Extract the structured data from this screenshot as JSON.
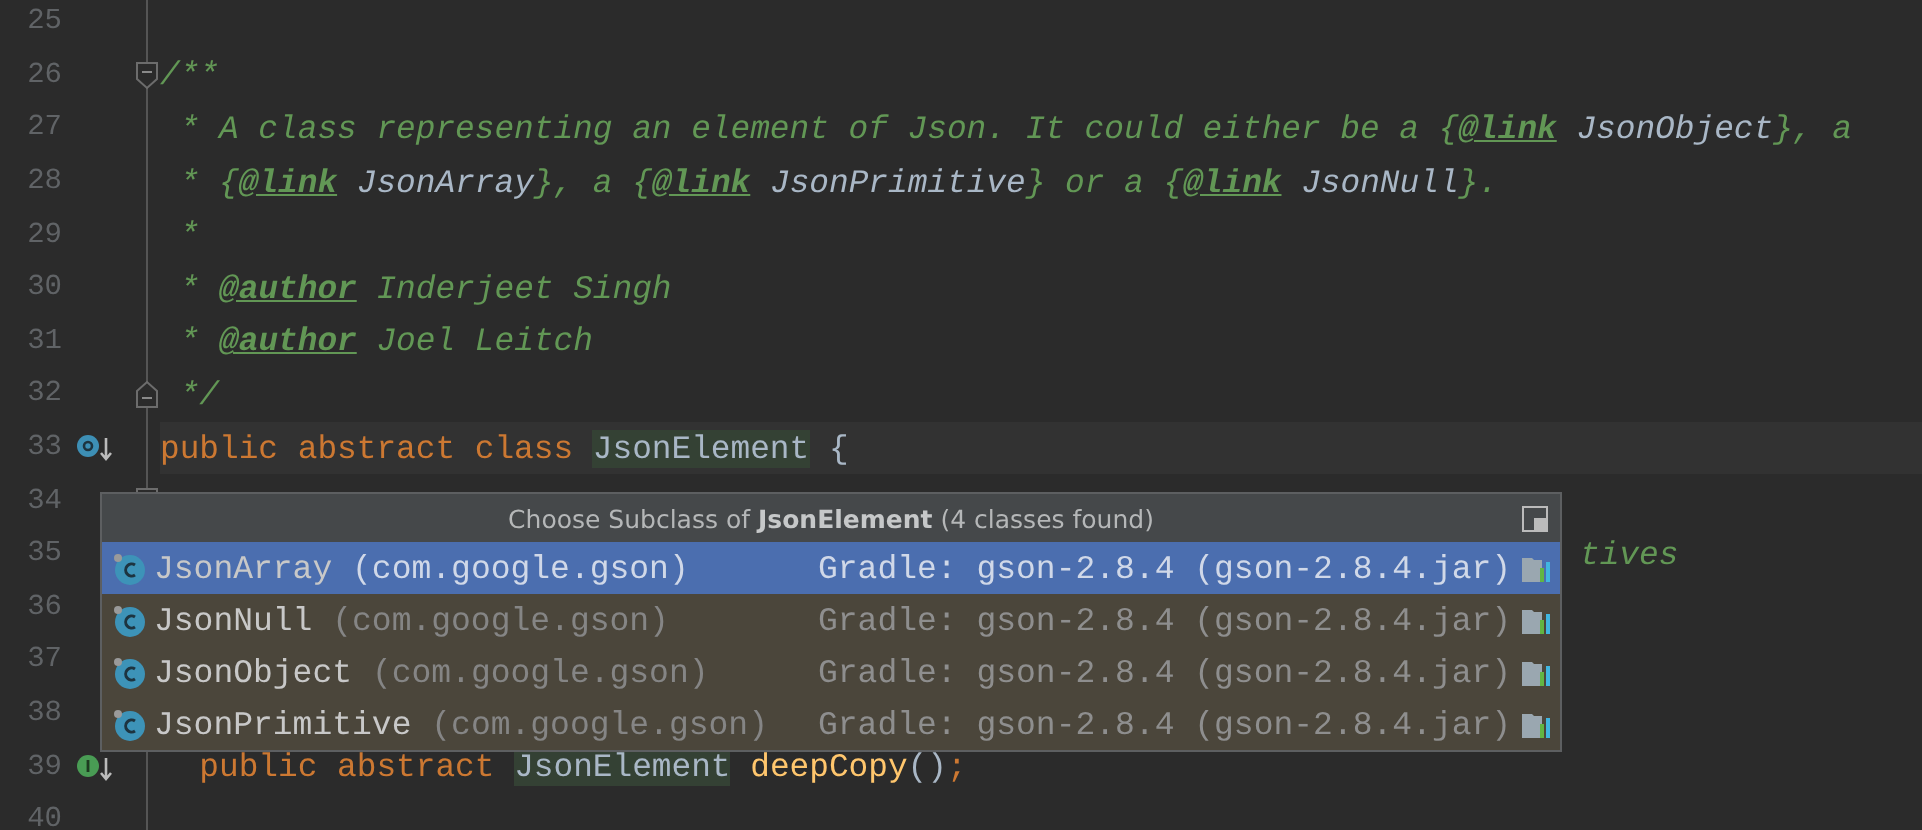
{
  "editor": {
    "lines": [
      {
        "number": "25"
      },
      {
        "number": "26",
        "fold_start": true,
        "tokens": [
          {
            "kind": "comment",
            "text": "/**"
          }
        ]
      },
      {
        "number": "27",
        "tokens": [
          {
            "kind": "comment",
            "text": " * A class representing an element of Json. It could either be a {"
          },
          {
            "kind": "tag",
            "text": "@link"
          },
          {
            "kind": "ref",
            "text": " JsonObject"
          },
          {
            "kind": "comment",
            "text": "}, a"
          }
        ]
      },
      {
        "number": "28",
        "tokens": [
          {
            "kind": "comment",
            "text": " * {"
          },
          {
            "kind": "tag",
            "text": "@link"
          },
          {
            "kind": "ref",
            "text": " JsonArray"
          },
          {
            "kind": "comment",
            "text": "}, a {"
          },
          {
            "kind": "tag",
            "text": "@link"
          },
          {
            "kind": "ref",
            "text": " JsonPrimitive"
          },
          {
            "kind": "comment",
            "text": "} or a {"
          },
          {
            "kind": "tag",
            "text": "@link"
          },
          {
            "kind": "ref",
            "text": " JsonNull"
          },
          {
            "kind": "comment",
            "text": "}."
          }
        ]
      },
      {
        "number": "29",
        "tokens": [
          {
            "kind": "comment",
            "text": " *"
          }
        ]
      },
      {
        "number": "30",
        "tokens": [
          {
            "kind": "comment",
            "text": " * "
          },
          {
            "kind": "tag",
            "text": "@author"
          },
          {
            "kind": "comment",
            "text": " Inderjeet Singh"
          }
        ]
      },
      {
        "number": "31",
        "tokens": [
          {
            "kind": "comment",
            "text": " * "
          },
          {
            "kind": "tag",
            "text": "@author"
          },
          {
            "kind": "comment",
            "text": " Joel Leitch"
          }
        ]
      },
      {
        "number": "32",
        "fold_end": true,
        "tokens": [
          {
            "kind": "comment",
            "text": " */"
          }
        ]
      },
      {
        "number": "33",
        "current": true,
        "has_subclasses": true,
        "tokens": [
          {
            "kind": "keyword",
            "text": "public abstract class "
          },
          {
            "kind": "plain",
            "text": "JsonElement",
            "highlighted": true
          },
          {
            "kind": "plain",
            "text": " {"
          }
        ]
      },
      {
        "number": "34",
        "fold_start": true
      },
      {
        "number": "35",
        "covered": true,
        "tokens": [
          {
            "kind": "comment",
            "text": "tives"
          }
        ]
      },
      {
        "number": "36"
      },
      {
        "number": "37"
      },
      {
        "number": "38"
      },
      {
        "number": "39",
        "implements": true,
        "tokens": [
          {
            "kind": "keyword",
            "text": "  public abstract "
          },
          {
            "kind": "plain",
            "text": "JsonElement",
            "highlighted": true
          },
          {
            "kind": "method",
            "text": " deepCopy"
          },
          {
            "kind": "plain",
            "text": "()"
          },
          {
            "kind": "keyword",
            "text": ";"
          }
        ]
      },
      {
        "number": "40"
      }
    ]
  },
  "chooser": {
    "title": "Choose Subclass of **JsonElement** (4 classes found)",
    "items": [
      {
        "name": "JsonArray",
        "package": "(com.google.gson)",
        "location": "Gradle: gson-2.8.4 (gson-2.8.4.jar)",
        "selected": true
      },
      {
        "name": "JsonNull",
        "package": "(com.google.gson)",
        "location": "Gradle: gson-2.8.4 (gson-2.8.4.jar)",
        "selected": false
      },
      {
        "name": "JsonObject",
        "package": "(com.google.gson)",
        "location": "Gradle: gson-2.8.4 (gson-2.8.4.jar)",
        "selected": false
      },
      {
        "name": "JsonPrimitive",
        "package": "(com.google.gson)",
        "location": "Gradle: gson-2.8.4 (gson-2.8.4.jar)",
        "selected": false
      }
    ]
  }
}
